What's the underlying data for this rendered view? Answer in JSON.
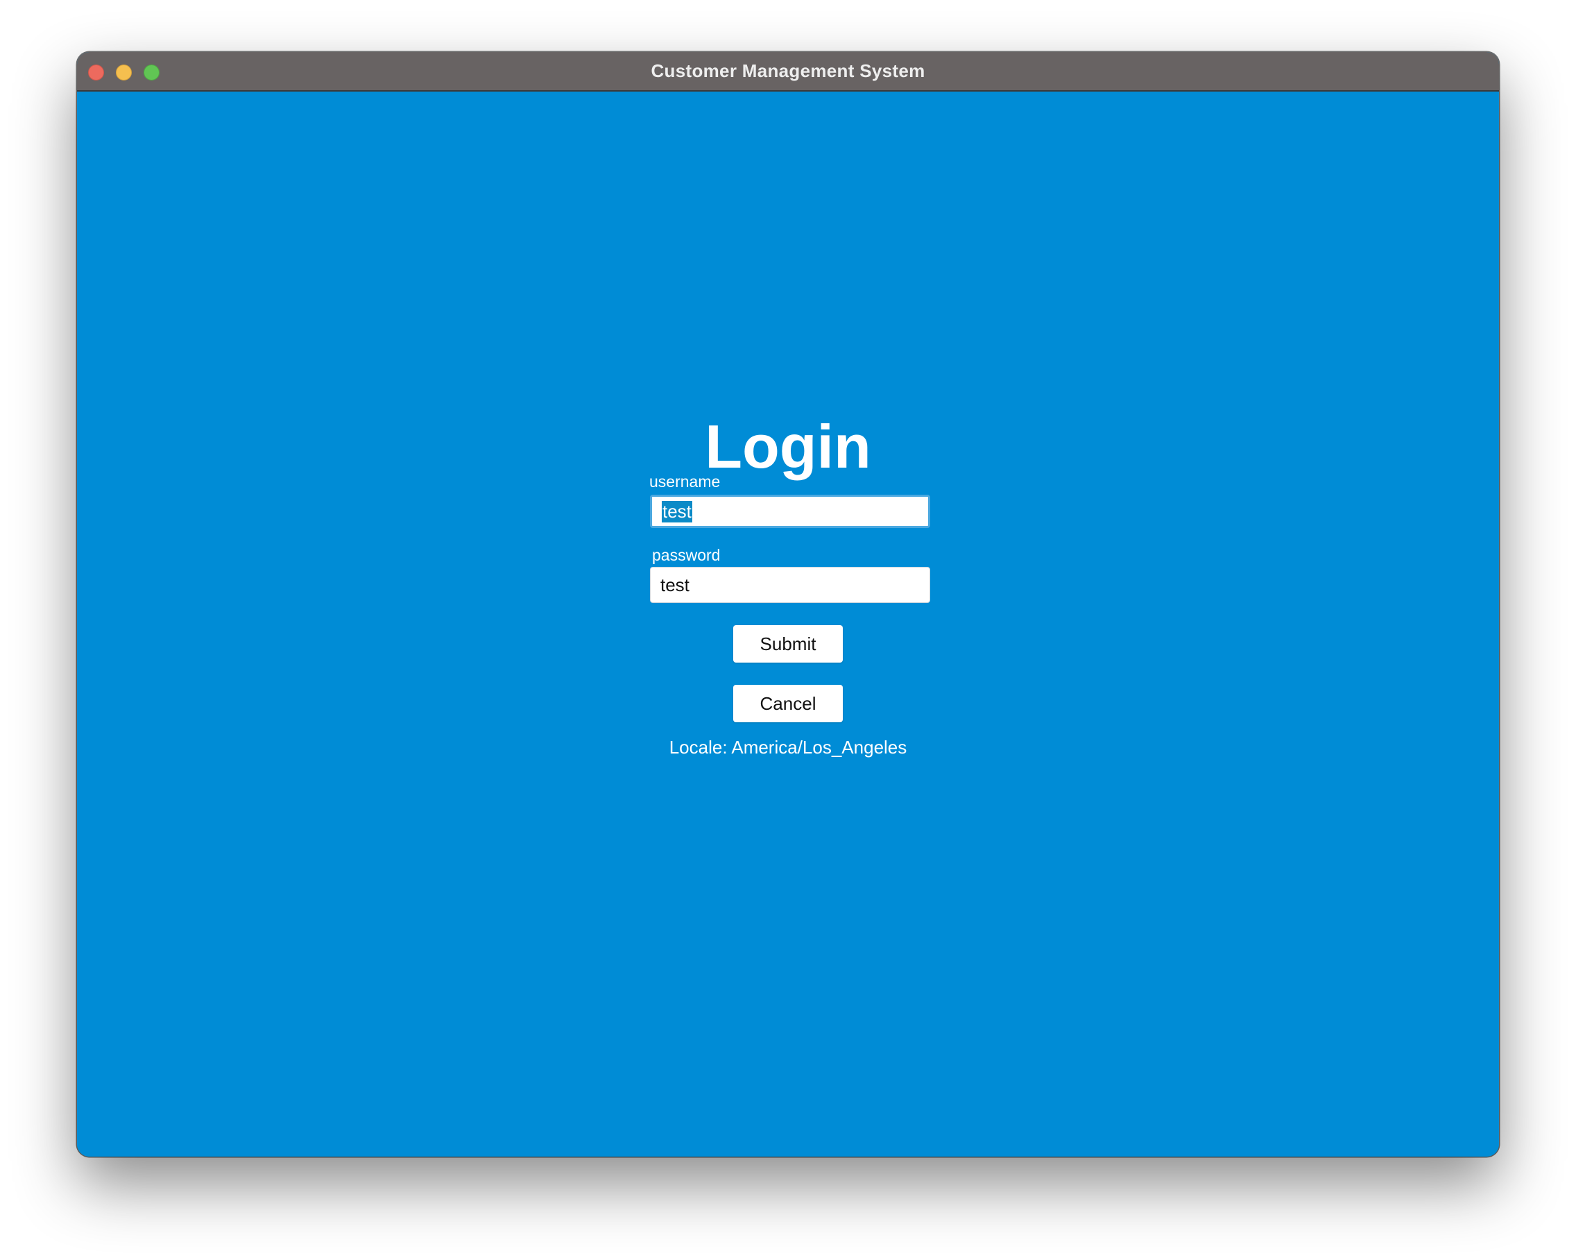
{
  "window": {
    "title": "Customer Management System",
    "accent_color": "#008cd6",
    "titlebar_color": "#686363"
  },
  "login": {
    "heading": "Login",
    "username_label": "username",
    "username_value": "test",
    "password_label": "password",
    "password_value": "test",
    "submit_label": "Submit",
    "cancel_label": "Cancel",
    "locale_text": "Locale: America/Los_Angeles"
  }
}
